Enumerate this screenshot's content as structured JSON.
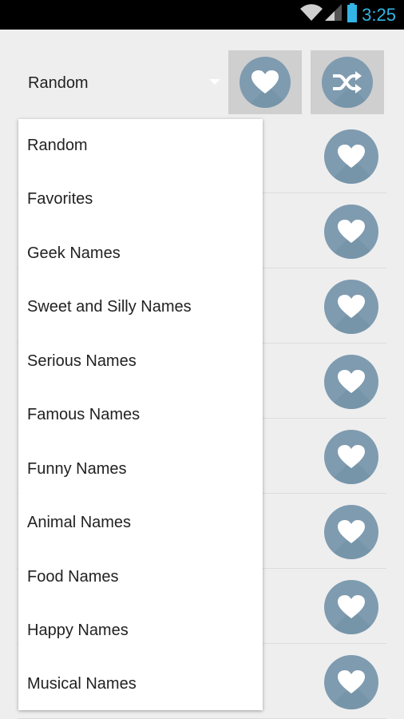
{
  "status_bar": {
    "time": "3:25",
    "icons": [
      "wifi-icon",
      "signal-icon",
      "battery-icon"
    ],
    "accent_color": "#33b5e5"
  },
  "spinner": {
    "selected": "Random"
  },
  "toolbar": {
    "favorite_icon": "heart-icon",
    "shuffle_icon": "shuffle-icon"
  },
  "dropdown": {
    "items": [
      "Random",
      "Favorites",
      "Geek Names",
      "Sweet and Silly Names",
      "Serious Names",
      "Famous Names",
      "Funny Names",
      "Animal Names",
      "Food Names",
      "Happy Names",
      "Musical Names"
    ]
  },
  "list": {
    "row_icon": "heart-icon",
    "row_count": 8
  },
  "colors": {
    "icon_circle": "#7f9bb0",
    "background": "#eeeeee",
    "button_bg": "#cfcfcf"
  }
}
